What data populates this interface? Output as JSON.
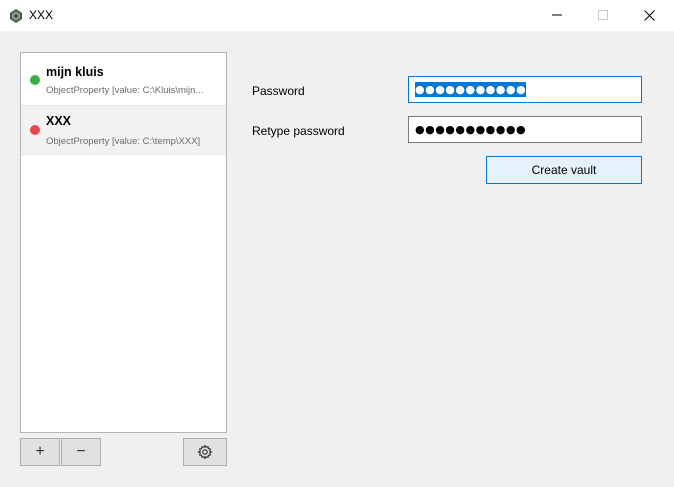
{
  "window": {
    "title": "XXX",
    "icon": "vault-icon"
  },
  "vaults": [
    {
      "name": "mijn kluis",
      "path": "ObjectProperty [value: C:\\Kluis\\mijn...",
      "status": "unlocked",
      "status_color": "#3cb043"
    },
    {
      "name": "XXX",
      "path": "ObjectProperty [value: C:\\temp\\XXX]",
      "status": "locked",
      "status_color": "#e8474c",
      "selected": true
    }
  ],
  "toolbar": {
    "add_label": "+",
    "remove_label": "−",
    "settings_icon": "gear-icon"
  },
  "form": {
    "password_label": "Password",
    "password_value": "●●●●●●●●●●●",
    "retype_label": "Retype password",
    "retype_value": "●●●●●●●●●●●",
    "create_label": "Create vault"
  },
  "colors": {
    "accent": "#0078d7",
    "unlocked": "#3cb043",
    "locked": "#e8474c"
  }
}
